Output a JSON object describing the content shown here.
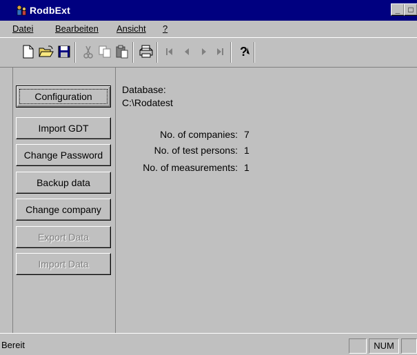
{
  "window": {
    "title": "RodbExt"
  },
  "title_buttons": {
    "minimize": "_",
    "restore": "□",
    "close": "×"
  },
  "menu": [
    {
      "label": "Datei"
    },
    {
      "label": "Bearbeiten"
    },
    {
      "label": "Ansicht"
    },
    {
      "label": "?"
    }
  ],
  "toolbar": {
    "icons": [
      "new-icon",
      "open-icon",
      "save-icon",
      "cut-icon",
      "copy-icon",
      "paste-icon",
      "print-icon",
      "first-record-icon",
      "prev-record-icon",
      "next-record-icon",
      "last-record-icon",
      "help-icon"
    ]
  },
  "buttons": [
    {
      "label": "Configuration",
      "enabled": true
    },
    {
      "label": "Import GDT",
      "enabled": true
    },
    {
      "label": "Change Password",
      "enabled": true
    },
    {
      "label": "Backup data",
      "enabled": true
    },
    {
      "label": "Change company",
      "enabled": true
    },
    {
      "label": "Export Data",
      "enabled": false
    },
    {
      "label": "Import Data",
      "enabled": false
    }
  ],
  "info": {
    "database_label": "Database:",
    "database_path": "C:\\Rodatest",
    "companies_label": "No. of companies:",
    "companies_value": "7",
    "testpersons_label": "No. of test persons:",
    "testpersons_value": "1",
    "measurements_label": "No. of measurements:",
    "measurements_value": "1"
  },
  "status": {
    "text": "Bereit",
    "num": "NUM"
  },
  "colors": {
    "titlebar": "#000080",
    "face": "#c0c0c0",
    "shadow": "#808080",
    "highlight": "#ffffff"
  }
}
